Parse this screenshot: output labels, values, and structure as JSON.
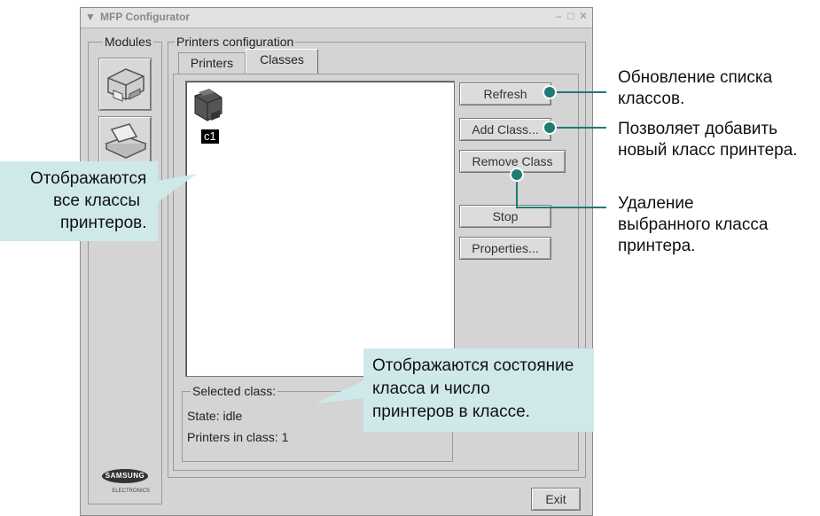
{
  "window": {
    "title": "MFP Configurator",
    "modules_label": "Modules",
    "printers_config_label": "Printers configuration",
    "tabs": [
      {
        "label": "Printers",
        "active": false
      },
      {
        "label": "Classes",
        "active": true
      }
    ],
    "class_items": [
      {
        "name": "c1"
      }
    ],
    "buttons": {
      "refresh": "Refresh",
      "add_class": "Add Class...",
      "remove_class": "Remove Class",
      "stop": "Stop",
      "properties": "Properties...",
      "exit": "Exit"
    },
    "selected_class": {
      "label": "Selected class:",
      "state": "State: idle",
      "printers": "Printers in class: 1"
    },
    "brand": {
      "name": "SAMSUNG",
      "sub": "ELECTRONICS"
    }
  },
  "callouts": {
    "left": [
      "Отображаются",
      "все классы",
      "принтеров."
    ],
    "bottom": [
      "Отображаются состояние",
      "класса и число",
      "принтеров в классе."
    ]
  },
  "annotations": {
    "refresh": [
      "Обновление списка",
      "классов."
    ],
    "add_class": [
      "Позволяет добавить",
      "новый класс принтера."
    ],
    "remove_class": [
      "Удаление",
      "выбранного класса",
      "принтера."
    ]
  },
  "colors": {
    "callout_bg": "#cfe9ea",
    "leader_line": "#1f7b74"
  }
}
